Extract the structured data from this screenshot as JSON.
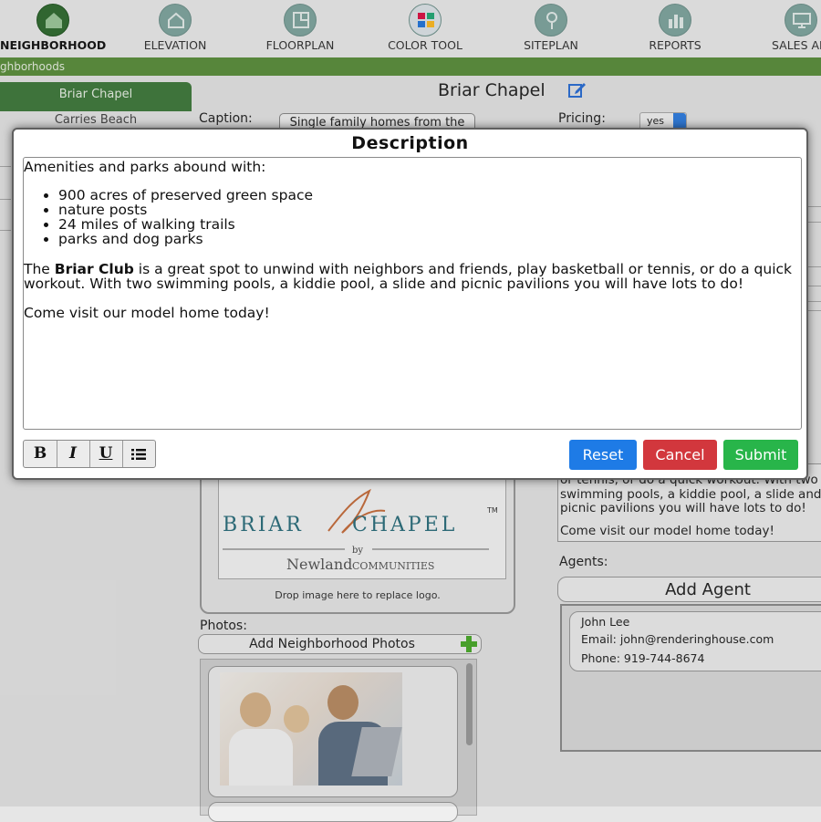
{
  "nav": {
    "items": [
      {
        "label": "NEIGHBORHOOD",
        "icon": "house-icon",
        "active": true
      },
      {
        "label": "ELEVATION",
        "icon": "elevation-icon"
      },
      {
        "label": "FLOORPLAN",
        "icon": "floorplan-icon"
      },
      {
        "label": "COLOR TOOL",
        "icon": "color-palette-icon"
      },
      {
        "label": "SITEPLAN",
        "icon": "map-pin-icon"
      },
      {
        "label": "REPORTS",
        "icon": "bar-chart-icon"
      },
      {
        "label": "SALES AP",
        "icon": "monitor-icon"
      }
    ]
  },
  "breadcrumb": "ghborhoods",
  "sidebar": {
    "selected": "Briar Chapel",
    "next": "Carries Beach"
  },
  "main": {
    "title": "Briar Chapel",
    "caption_label": "Caption:",
    "caption_value": "Single family homes from the",
    "pricing_label": "Pricing:",
    "pricing_value": "yes",
    "logo_drop_text": "Drop image here to replace logo.",
    "photos_label": "Photos:",
    "add_photos_label": "Add Neighborhood Photos",
    "description_preview": [
      "or tennis, or do a quick workout. With two",
      "swimming pools, a kiddie pool, a slide and",
      "picnic pavilions you will have lots to do!",
      "",
      "Come visit our model home today!"
    ],
    "agents_label": "Agents:",
    "add_agent_label": "Add Agent",
    "agent": {
      "name": "John Lee",
      "email": "Email: john@renderinghouse.com",
      "phone": "Phone: 919-744-8674"
    }
  },
  "logo": {
    "line1a": "BRIAR",
    "line1b": "CHAPEL",
    "tm": "TM",
    "by": "by",
    "newland": "Newland",
    "communities": "COMMUNITIES"
  },
  "modal": {
    "title": "Description",
    "intro": "Amenities and parks abound with:",
    "bullets": [
      "900 acres of preserved green space",
      "nature posts",
      "24 miles of walking trails",
      "parks and dog parks"
    ],
    "para_prefix": "The ",
    "para_bold": "Briar Club",
    "para_rest": " is a great spot to unwind with neighbors and friends, play basketball or tennis, or do a quick",
    "para_line2": "workout. With two swimming pools, a kiddie pool, a slide and picnic pavilions you will have lots to do!",
    "closing": "Come visit our model home today!",
    "toolbar": {
      "bold": "B",
      "italic": "I",
      "underline": "U"
    },
    "buttons": {
      "reset": "Reset",
      "cancel": "Cancel",
      "submit": "Submit"
    }
  },
  "colors": {
    "accent_green": "#5b8f3c",
    "reset_blue": "#1e7be6",
    "cancel_red": "#d2373d",
    "submit_green": "#28b54a"
  }
}
